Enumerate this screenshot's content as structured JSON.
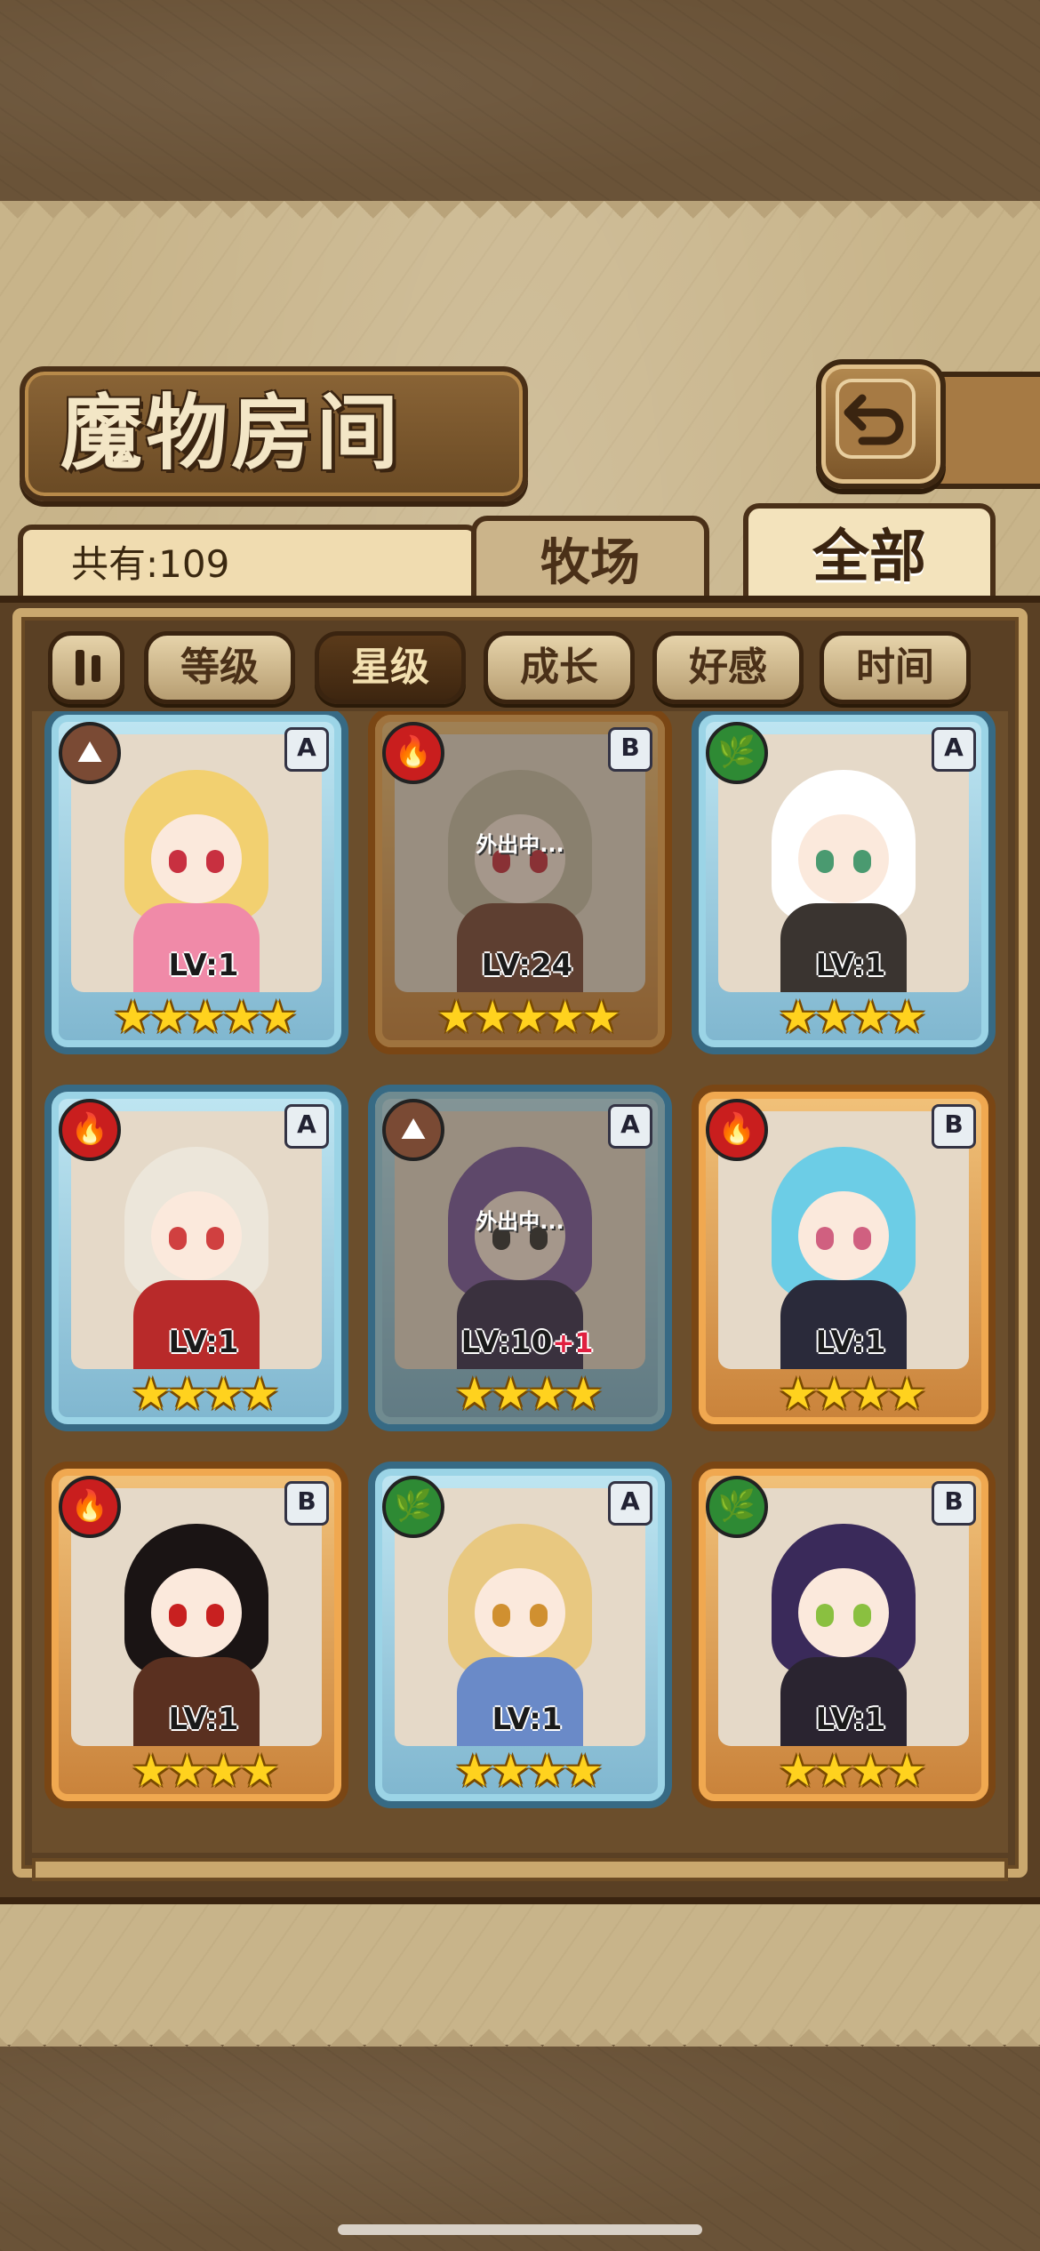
{
  "header": {
    "title": "魔物房间"
  },
  "count": {
    "label": "共有:109"
  },
  "tabs": [
    {
      "label": "牧场",
      "active": false
    },
    {
      "label": "全部",
      "active": true
    }
  ],
  "sort_buttons": [
    {
      "label": "等级",
      "active": false
    },
    {
      "label": "星级",
      "active": true
    },
    {
      "label": "成长",
      "active": false
    },
    {
      "label": "好感",
      "active": false
    },
    {
      "label": "时间",
      "active": false
    }
  ],
  "monsters": [
    {
      "element": "earth",
      "element_icon": "mountain-icon",
      "rank": "A",
      "frame": "blue",
      "level": "LV:1",
      "stars": "★★★★★",
      "away": "",
      "bonus": "",
      "hair": "#f2d070",
      "outfit": "#f08aa8",
      "eyes": "#c83040"
    },
    {
      "element": "fire",
      "element_icon": "flame-icon",
      "rank": "B",
      "frame": "orange",
      "level": "LV:24",
      "stars": "★★★★★",
      "away": "外出中...",
      "bonus": "",
      "hair": "#c8c0a8",
      "outfit": "#7a4a3a",
      "eyes": "#c83040"
    },
    {
      "element": "grass",
      "element_icon": "leaf-icon",
      "rank": "A",
      "frame": "blue",
      "level": "LV:1",
      "stars": "★★★★",
      "away": "",
      "bonus": "",
      "hair": "#ffffff",
      "outfit": "#3a3430",
      "eyes": "#4a9a70"
    },
    {
      "element": "fire",
      "element_icon": "flame-icon",
      "rank": "A",
      "frame": "blue",
      "level": "LV:1",
      "stars": "★★★★",
      "away": "",
      "bonus": "",
      "hair": "#ece6da",
      "outfit": "#b82a2a",
      "eyes": "#d04040"
    },
    {
      "element": "earth",
      "element_icon": "mountain-icon",
      "rank": "A",
      "frame": "blue",
      "level": "LV:10",
      "stars": "★★★★",
      "away": "外出中...",
      "bonus": "+1",
      "hair": "#7a5aa0",
      "outfit": "#3a3050",
      "eyes": "#333333"
    },
    {
      "element": "fire",
      "element_icon": "flame-icon",
      "rank": "B",
      "frame": "orange",
      "level": "LV:1",
      "stars": "★★★★",
      "away": "",
      "bonus": "",
      "hair": "#6ccde6",
      "outfit": "#2a2a3a",
      "eyes": "#d06080"
    },
    {
      "element": "fire",
      "element_icon": "flame-icon",
      "rank": "B",
      "frame": "orange",
      "level": "LV:1",
      "stars": "★★★★",
      "away": "",
      "bonus": "",
      "hair": "#1a1414",
      "outfit": "#5a3020",
      "eyes": "#c82020"
    },
    {
      "element": "grass",
      "element_icon": "leaf-icon",
      "rank": "A",
      "frame": "blue",
      "level": "LV:1",
      "stars": "★★★★",
      "away": "",
      "bonus": "",
      "hair": "#e8c880",
      "outfit": "#6a8ac8",
      "eyes": "#d09030"
    },
    {
      "element": "grass",
      "element_icon": "leaf-icon",
      "rank": "B",
      "frame": "orange",
      "level": "LV:1",
      "stars": "★★★★",
      "away": "",
      "bonus": "",
      "hair": "#3a2a5a",
      "outfit": "#2a2430",
      "eyes": "#8ac040"
    }
  ]
}
